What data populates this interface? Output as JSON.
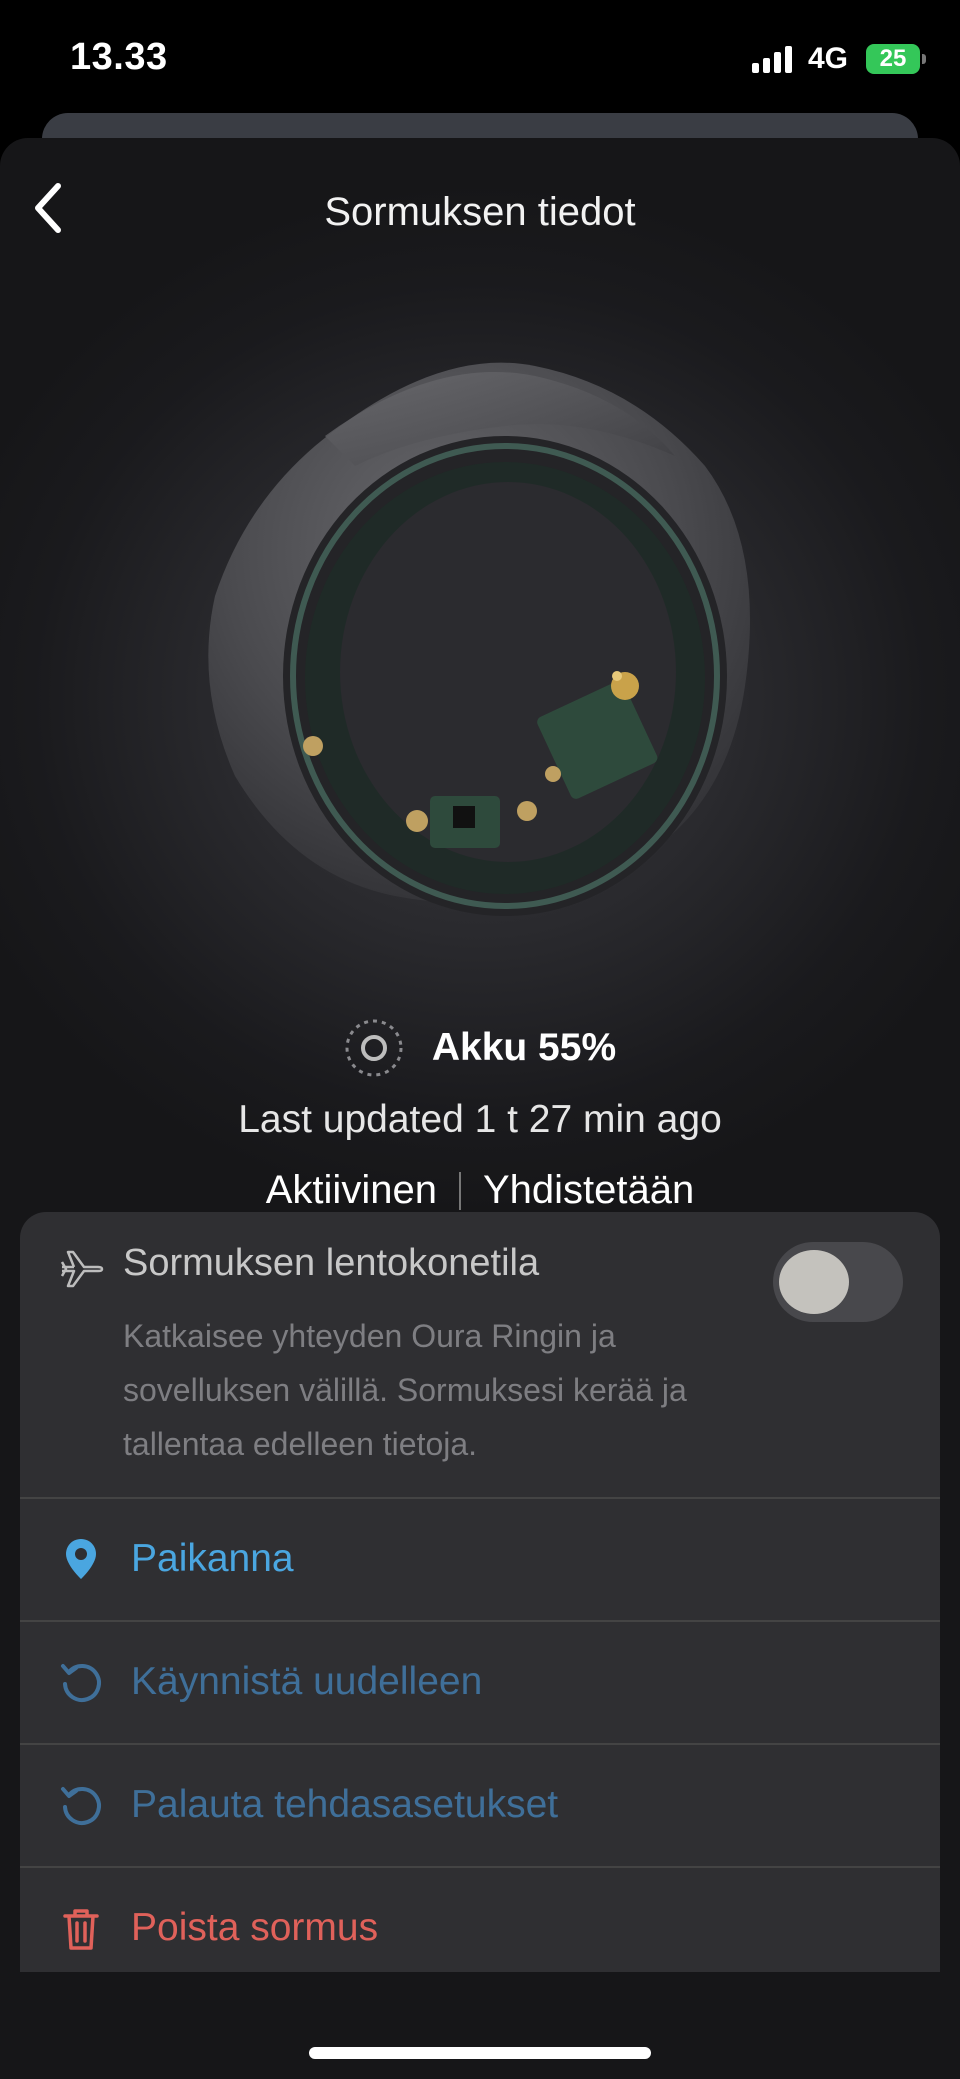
{
  "status_bar": {
    "time": "13.33",
    "network": "4G",
    "battery": "25"
  },
  "header": {
    "title": "Sormuksen tiedot",
    "back_icon": "chevron-left-icon"
  },
  "ring": {
    "image_icon": "oura-ring-image"
  },
  "battery": {
    "label": "Akku 55%",
    "level": 0.55
  },
  "last_updated": "Last updated 1 t 27 min ago",
  "state": {
    "active": "Aktiivinen",
    "connection": "Yhdistetään"
  },
  "airplane_mode": {
    "title": "Sormuksen lentokonetila",
    "description": "Katkaisee yhteyden Oura Ringin ja sovelluksen välillä. Sormuksesi kerää ja tallentaa edelleen tietoja.",
    "enabled": false
  },
  "menu": {
    "locate": "Paikanna",
    "restart": "Käynnistä uudelleen",
    "factory_reset": "Palauta tehdasasetukset",
    "remove": "Poista sormus"
  },
  "colors": {
    "link_blue": "#4aa6e0",
    "muted_blue": "#3f6f99",
    "danger_red": "#e0615a",
    "battery_green": "#34c759"
  }
}
